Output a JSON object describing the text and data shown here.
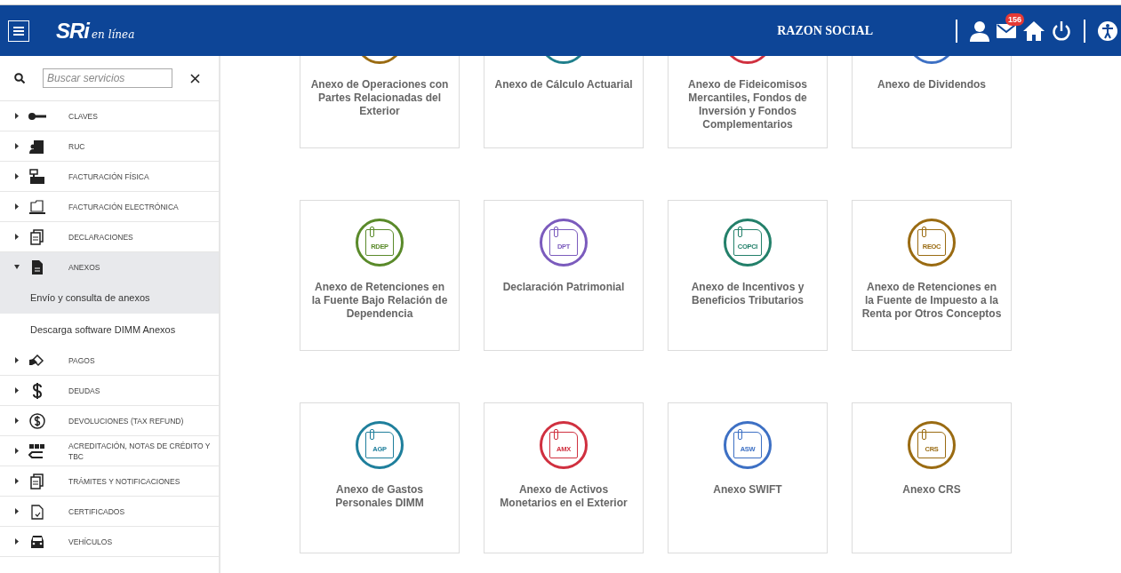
{
  "header": {
    "logo": "SRi",
    "logo_tagline": "en línea",
    "account": "RAZON SOCIAL",
    "mail_badge": "156"
  },
  "search": {
    "placeholder": "Buscar servicios"
  },
  "menu": [
    {
      "label": "CLAVES",
      "expanded": false
    },
    {
      "label": "RUC",
      "expanded": false
    },
    {
      "label": "FACTURACIÓN FÍSICA",
      "expanded": false
    },
    {
      "label": "FACTURACIÓN ELECTRÓNICA",
      "expanded": false
    },
    {
      "label": "DECLARACIONES",
      "expanded": false
    },
    {
      "label": "ANEXOS",
      "expanded": true,
      "children": [
        {
          "label": "Envío y consulta de anexos",
          "selected": true
        },
        {
          "label": "Descarga software DIMM Anexos",
          "selected": false
        }
      ]
    },
    {
      "label": "PAGOS",
      "expanded": false
    },
    {
      "label": "DEUDAS",
      "expanded": false
    },
    {
      "label": "DEVOLUCIONES (TAX REFUND)",
      "expanded": false
    },
    {
      "label": "ACREDITACIÓN, NOTAS DE CRÉDITO Y TBC",
      "expanded": false
    },
    {
      "label": "TRÁMITES Y NOTIFICACIONES",
      "expanded": false
    },
    {
      "label": "CERTIFICADOS",
      "expanded": false
    },
    {
      "label": "VEHÍCULOS",
      "expanded": false
    }
  ],
  "cards": [
    {
      "title": "Anexo de Operaciones con Partes Relacionadas del Exterior",
      "color": "#9a6b12"
    },
    {
      "title": "Anexo de Cálculo Actuarial",
      "color": "#1f7f8c"
    },
    {
      "title": "Anexo de Fideicomisos Mercantiles, Fondos de Inversión y Fondos Complementarios",
      "color": "#d0303f"
    },
    {
      "title": "Anexo de Dividendos",
      "color": "#3d70c4"
    },
    {
      "title": "Anexo de Retenciones en la Fuente Bajo Relación de Dependencia",
      "code": "RDEP",
      "color": "#5a8a2a"
    },
    {
      "title": "Declaración Patrimonial",
      "code": "DPT",
      "color": "#7b5bbd"
    },
    {
      "title": "Anexo de Incentivos y Beneficios Tributarios",
      "code": "COPCI",
      "color": "#23806a"
    },
    {
      "title": "Anexo de Retenciones en la Fuente de Impuesto a la Renta por Otros Conceptos",
      "code": "REOC",
      "color": "#9a6b12"
    },
    {
      "title": "Anexo de Gastos Personales DIMM",
      "code": "AGP",
      "color": "#1f7f9c"
    },
    {
      "title": "Anexo de Activos Monetarios en el Exterior",
      "code": "AMX",
      "color": "#d0303f"
    },
    {
      "title": "Anexo SWIFT",
      "code": "ASW",
      "color": "#3d70c4"
    },
    {
      "title": "Anexo CRS",
      "code": "CRS",
      "color": "#9a6b12"
    }
  ]
}
